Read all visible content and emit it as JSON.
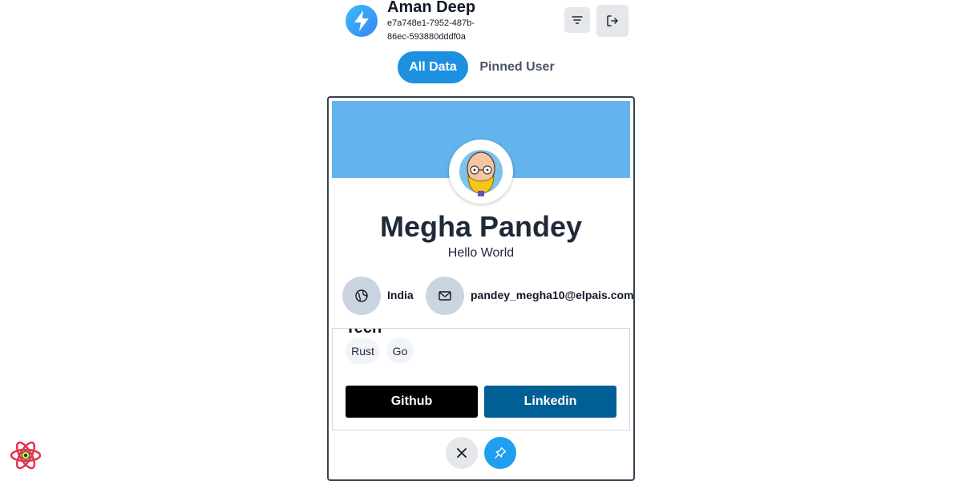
{
  "header": {
    "user_name": "Aman Deep",
    "user_id": "e7a748e1-7952-487b-86ec-593880dddf0a",
    "logo_icon": "lightning-bolt-icon",
    "filter_icon": "filter-lines-icon",
    "logout_icon": "logout-icon"
  },
  "tabs": [
    {
      "label": "All Data",
      "active": true
    },
    {
      "label": "Pinned User",
      "active": false
    }
  ],
  "profile": {
    "name": "Megha Pandey",
    "bio": "Hello World",
    "country": "India",
    "email": "pandey_megha10@elpais.com",
    "tech_heading": "Tech",
    "tech": [
      "Rust",
      "Go"
    ],
    "github_label": "Github",
    "linkedin_label": "Linkedin"
  },
  "actions": {
    "close_icon": "close-icon",
    "pin_icon": "pin-icon"
  },
  "colors": {
    "banner": "#63b3ed",
    "active_tab": "#1e90e0",
    "github": "#000000",
    "linkedin": "#005f94",
    "pin": "#1e9ff0"
  }
}
